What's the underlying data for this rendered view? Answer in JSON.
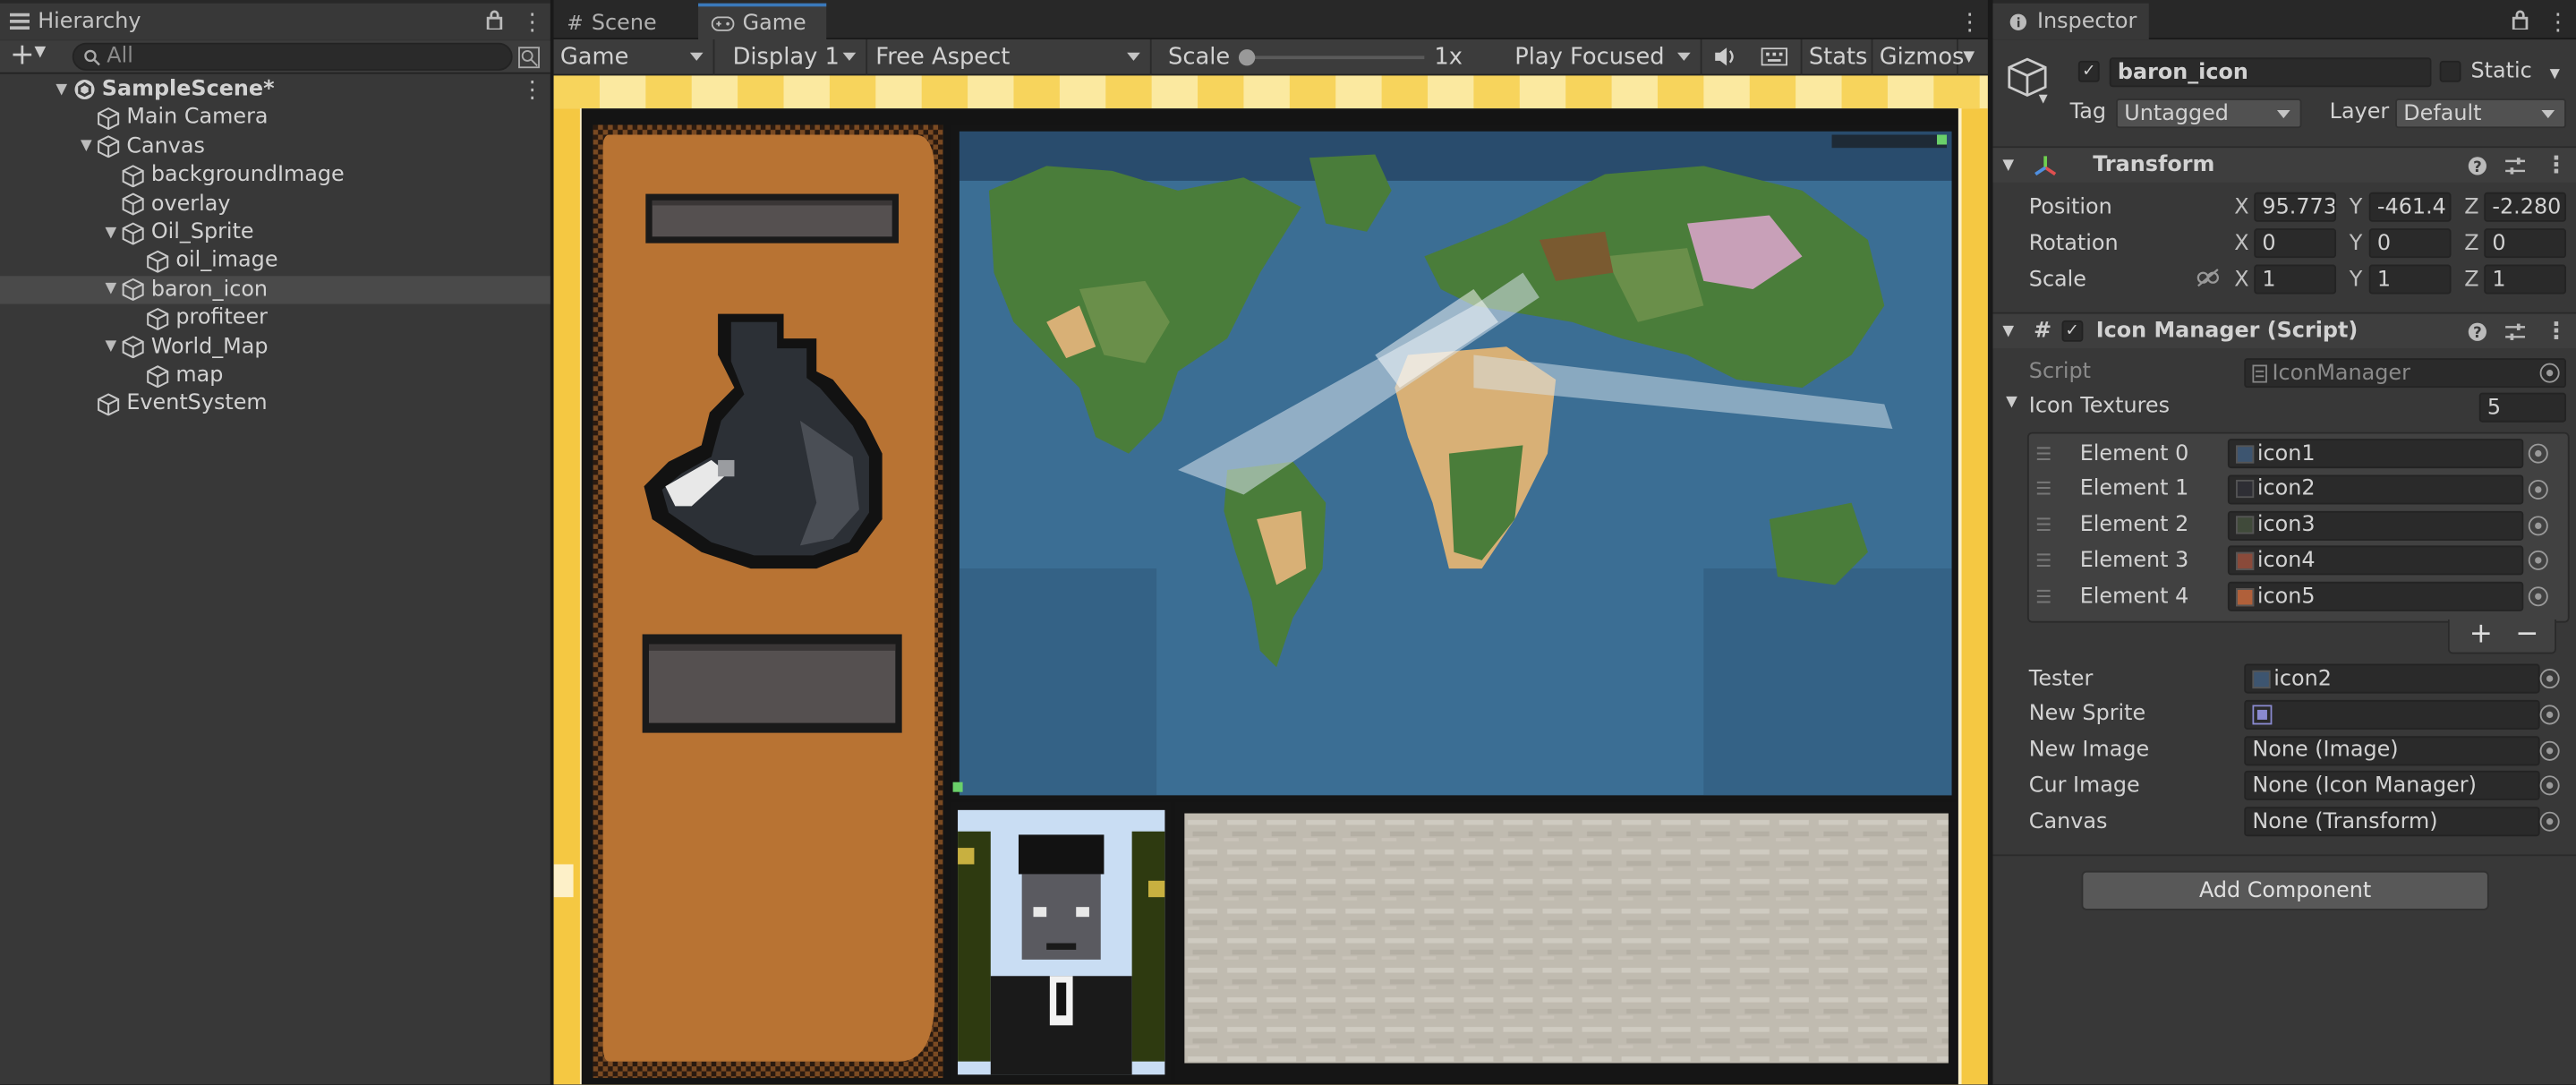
{
  "hierarchy": {
    "tab_label": "Hierarchy",
    "search_placeholder": "All",
    "items": [
      {
        "label": "SampleScene*",
        "depth": 0,
        "expanded": true,
        "scene": true
      },
      {
        "label": "Main Camera",
        "depth": 1
      },
      {
        "label": "Canvas",
        "depth": 1,
        "expanded": true
      },
      {
        "label": "backgroundImage",
        "depth": 2
      },
      {
        "label": "overlay",
        "depth": 2
      },
      {
        "label": "Oil_Sprite",
        "depth": 2,
        "expanded": true
      },
      {
        "label": "oil_image",
        "depth": 3
      },
      {
        "label": "baron_icon",
        "depth": 2,
        "expanded": true,
        "selected": true
      },
      {
        "label": "profiteer",
        "depth": 3
      },
      {
        "label": "World_Map",
        "depth": 2,
        "expanded": true
      },
      {
        "label": "map",
        "depth": 3
      },
      {
        "label": "EventSystem",
        "depth": 1
      }
    ]
  },
  "game_view": {
    "tabs": [
      {
        "label": "Scene"
      },
      {
        "label": "Game"
      }
    ],
    "toolbar": {
      "view_dropdown": "Game",
      "display_dropdown": "Display 1",
      "aspect_dropdown": "Free Aspect",
      "scale_label": "Scale",
      "scale_value": "1x",
      "scale_fraction": 0.0,
      "play_mode": "Play Focused",
      "stats_label": "Stats",
      "gizmos_label": "Gizmos"
    }
  },
  "inspector": {
    "tab_label": "Inspector",
    "object_name": "baron_icon",
    "static_label": "Static",
    "tag_label": "Tag",
    "tag_value": "Untagged",
    "layer_label": "Layer",
    "layer_value": "Default",
    "transform": {
      "header": "Transform",
      "position_label": "Position",
      "rotation_label": "Rotation",
      "scale_label": "Scale",
      "position": {
        "x": "95.773",
        "y": "-461.4",
        "z": "-2.280"
      },
      "rotation": {
        "x": "0",
        "y": "0",
        "z": "0"
      },
      "scale": {
        "x": "1",
        "y": "1",
        "z": "1"
      }
    },
    "script_component": {
      "header": "Icon Manager (Script)",
      "script_label": "Script",
      "script_value": "IconManager",
      "icon_textures_label": "Icon Textures",
      "icon_textures_count": "5",
      "elements": [
        {
          "label": "Element 0",
          "value": "icon1"
        },
        {
          "label": "Element 1",
          "value": "icon2"
        },
        {
          "label": "Element 2",
          "value": "icon3"
        },
        {
          "label": "Element 3",
          "value": "icon4"
        },
        {
          "label": "Element 4",
          "value": "icon5"
        }
      ],
      "fields": [
        {
          "label": "Tester",
          "value": "icon2"
        },
        {
          "label": "New Sprite",
          "value": ""
        },
        {
          "label": "New Image",
          "value": "None (Image)"
        },
        {
          "label": "Cur Image",
          "value": "None (Icon Manager)"
        },
        {
          "label": "Canvas",
          "value": "None (Transform)"
        }
      ]
    },
    "add_component_label": "Add Component"
  },
  "colors": {
    "accent_tab": "#3a79bb",
    "panel_bg": "#383838",
    "game_border": "#f5c842",
    "oil_panel": "#b87333",
    "ocean": "#3b6e94",
    "land": "#4a7d3a",
    "desert": "#d8b076"
  }
}
